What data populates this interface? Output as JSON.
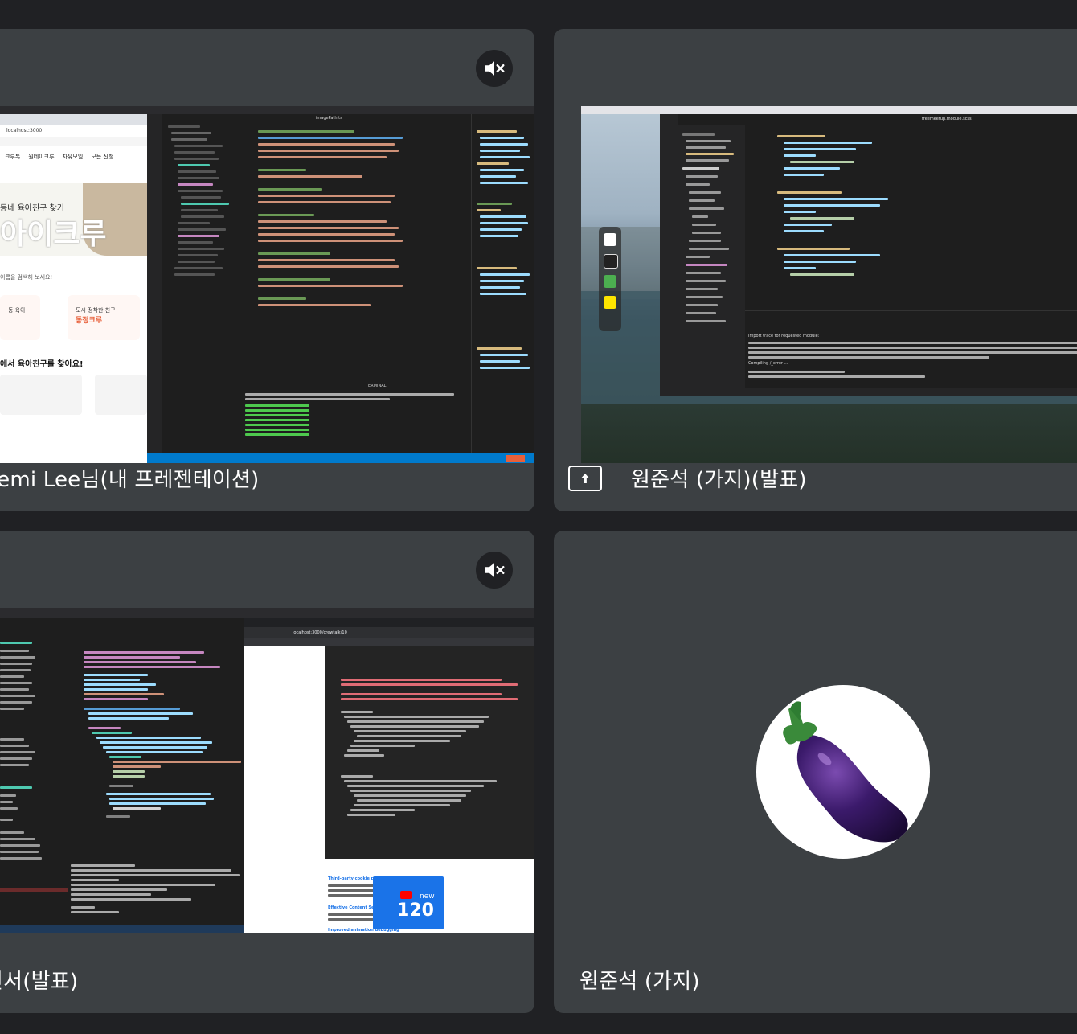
{
  "tiles": [
    {
      "participant_name": "aemi Lee님(내 프레젠테이션)",
      "muted": true,
      "mute_icon": "mic-off-icon",
      "shared_screen": {
        "browser_url": "localhost:3000",
        "nav_items": [
          "크루톡",
          "원데이크루",
          "자유모임",
          "모든 신청"
        ],
        "hero_subtitle": "동네 육아친구 찾기",
        "hero_title": "아이크루",
        "search_hint": "이름을 검색해 보세요!",
        "card_1_label": "동 육아",
        "card_2_label": "도시 정착한 친구",
        "card_2_title": "동정크루",
        "section_title": "에서 육아친구를 찾아요!",
        "editor_tab": "imagePath.ts",
        "terminal_label": "TERMINAL"
      }
    },
    {
      "participant_name": "원준석 (가지)(발표)",
      "presenting_icon": "present-to-all-icon",
      "shared_screen": {
        "editor_tab": "freemeetup.module.scss",
        "terminal_line": "Import trace for requested module:",
        "compile_line": "Compiling /_error ..."
      }
    },
    {
      "participant_name": "진서(발표)",
      "muted": true,
      "mute_icon": "mic-off-icon",
      "shared_screen": {
        "browser_url": "localhost:3000/crewtalk/10",
        "devtools_heading": "Third-party cookie phaseout",
        "devtools_heading_2": "Effective Content Security Policy",
        "devtools_heading_3": "Improved animation debugging",
        "promo_new": "new",
        "promo_number": "120"
      }
    },
    {
      "participant_name": "원준석 (가지)",
      "avatar_icon": "eggplant-icon"
    }
  ],
  "colors": {
    "background": "#202124",
    "tile": "#3c4043",
    "vscode_status": "#007acc",
    "eggplant": "#3b1a6b"
  }
}
